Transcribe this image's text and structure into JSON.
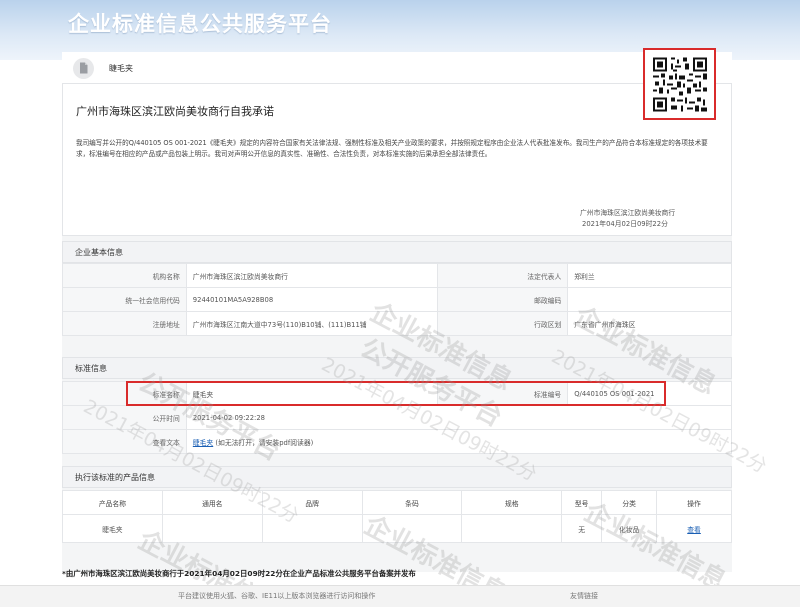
{
  "header": {
    "title": "企业标准信息公共服务平台"
  },
  "tab": {
    "label": "睫毛夹",
    "icon": "document-icon"
  },
  "commitment": {
    "title": "广州市海珠区滨江欧尚美妆商行自我承诺",
    "text": "我司编写并公开的Q/440105 OS 001-2021《睫毛夹》规定的内容符合国家有关法律法规、强制性标准及相关产业政策的要求，并按照规定程序由企业法人代表批准发布。我司生产的产品符合本标准规定的各项技术要求，标准编号在相应的产品或产品包装上明示。我司对声明公开信息的真实性、准确性、合法性负责，对本标准实施的后果承担全部法律责任。",
    "sign_company": "广州市海珠区滨江欧尚美妆商行",
    "sign_time": "2021年04月02日09时22分"
  },
  "company": {
    "section_title": "企业基本信息",
    "rows": [
      {
        "l1": "机构名称",
        "v1": "广州市海珠区滨江欧尚美妆商行",
        "l2": "法定代表人",
        "v2": "郑利兰"
      },
      {
        "l1": "统一社会信用代码",
        "v1": "92440101MA5A928B08",
        "l2": "邮政编码",
        "v2": ""
      },
      {
        "l1": "注册地址",
        "v1": "广州市海珠区江南大道中73号(110)B10铺、(111)B11铺",
        "l2": "行政区划",
        "v2": "广东省广州市海珠区"
      }
    ]
  },
  "standard": {
    "section_title": "标准信息",
    "name_label": "标准名称",
    "name_value": "睫毛夹",
    "code_label": "标准编号",
    "code_value": "Q/440105 OS 001-2021",
    "time_label": "公开时间",
    "time_value": "2021-04-02 09:22:28",
    "text_label": "查看文本",
    "text_link": "睫毛夹",
    "text_note": "(如无法打开，请安装pdf阅读器)"
  },
  "products": {
    "section_title": "执行该标准的产品信息",
    "columns": [
      "产品名称",
      "通用名",
      "品牌",
      "条码",
      "规格",
      "型号",
      "分类",
      "操作"
    ],
    "rows": [
      {
        "name": "睫毛夹",
        "common": "",
        "brand": "",
        "barcode": "",
        "spec": "",
        "model": "无",
        "category": "化妆品",
        "action": "查看"
      }
    ]
  },
  "watermark": {
    "line1": "企业标准信息",
    "line2": "公开服务平台",
    "date": "2021年04月02日09时22分"
  },
  "footnote": "*由广州市海珠区滨江欧尚美妆商行于2021年04月02日09时22分在企业产品标准公共服务平台备案并发布",
  "footer": {
    "notice": "平台建议使用火狐、谷歌、IE11以上版本浏览器进行访问和操作",
    "links": "友情链接"
  },
  "colors": {
    "highlight": "#d92b2b",
    "link": "#1a5fb4",
    "banner": "#b9d2ec"
  }
}
